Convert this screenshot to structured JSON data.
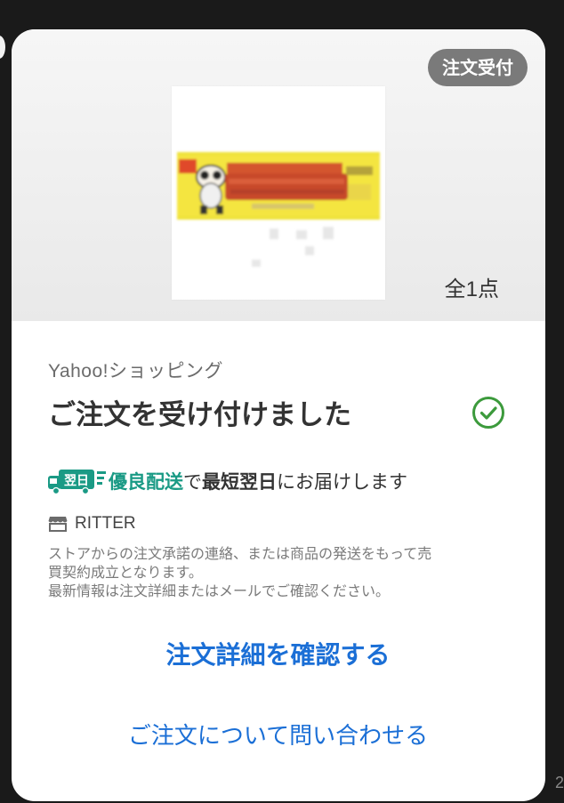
{
  "order": {
    "status_badge": "注文受付",
    "item_count": "全1点",
    "store_service": "Yahoo!ショッピング",
    "title": "ご注文を受け付けました",
    "delivery": {
      "badge_text": "翌日",
      "tier": "優良配送",
      "text_1": "で",
      "highlight": "最短翌日",
      "text_2": "にお届けします"
    },
    "shop_name": "RITTER",
    "notice_lines": [
      "ストアからの注文承諾の連絡、または商品の発送をもって売",
      "買契約成立となります。",
      "最新情報は注文詳細またはメールでご確認ください。"
    ],
    "detail_link": "注文詳細を確認する",
    "contact_link": "ご注文について問い合わせる"
  },
  "corner_number": "2",
  "icons": {
    "status": "check-circle-icon",
    "delivery": "delivery-truck-icon",
    "shop": "shop-icon"
  },
  "colors": {
    "accent_link": "#1b6fd6",
    "delivery_green": "#1a9a85",
    "check_green": "#3c9a3c",
    "badge_gray": "#7a7a7a"
  }
}
